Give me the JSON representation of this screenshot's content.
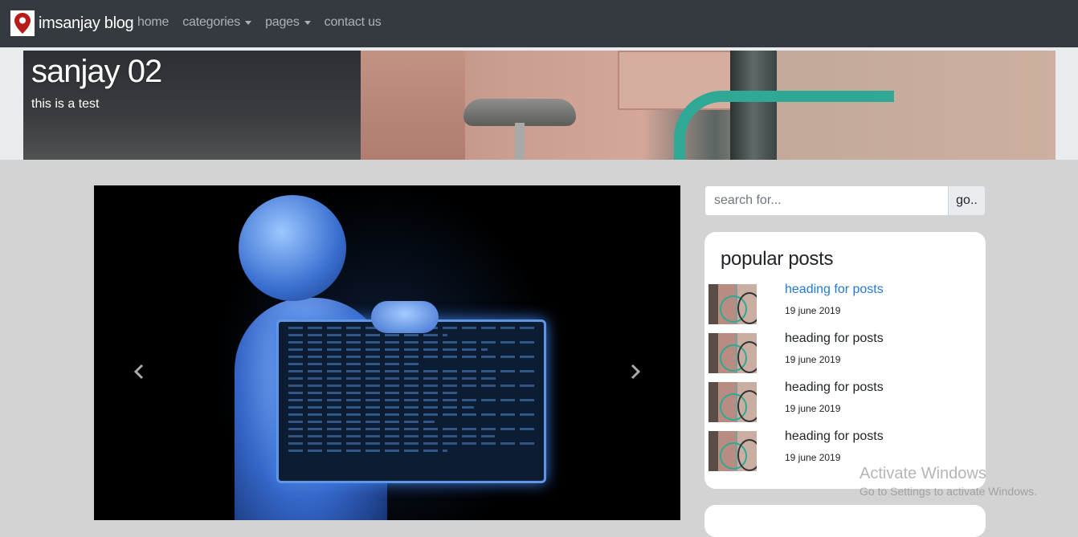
{
  "navbar": {
    "brand": "imsanjay blog",
    "links": [
      {
        "label": "home",
        "dropdown": false
      },
      {
        "label": "categories",
        "dropdown": true
      },
      {
        "label": "pages",
        "dropdown": true
      },
      {
        "label": "contact us",
        "dropdown": false
      }
    ]
  },
  "hero": {
    "title": "sanjay 02",
    "subtitle": "this is a test"
  },
  "search": {
    "placeholder": "search for...",
    "button_label": "go.."
  },
  "popular": {
    "title": "popular posts",
    "posts": [
      {
        "title": "heading for posts",
        "date": "19 june 2019",
        "active": true
      },
      {
        "title": "heading for posts",
        "date": "19 june 2019",
        "active": false
      },
      {
        "title": "heading for posts",
        "date": "19 june 2019",
        "active": false
      },
      {
        "title": "heading for posts",
        "date": "19 june 2019",
        "active": false
      }
    ]
  },
  "watermark": {
    "line1": "Activate Windows",
    "line2": "Go to Settings to activate Windows."
  },
  "colors": {
    "navbar_bg": "#343a40",
    "page_bg": "#d3d3d3",
    "link_active": "#2178d6"
  }
}
